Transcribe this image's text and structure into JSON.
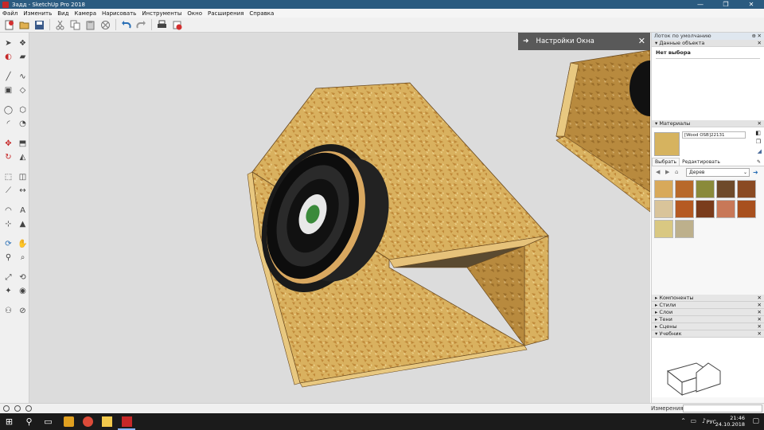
{
  "window": {
    "title": "Задд - SketchUp Pro 2018",
    "minimize": "—",
    "maximize": "❐",
    "close": "✕"
  },
  "menu": [
    "Файл",
    "Изменить",
    "Вид",
    "Камера",
    "Нарисовать",
    "Инструменты",
    "Окно",
    "Расширения",
    "Справка"
  ],
  "toolbar_icons": [
    "new-file-icon",
    "open-folder-icon",
    "save-icon",
    "cut-icon",
    "copy-icon",
    "paste-icon",
    "erase-icon",
    "undo-icon",
    "redo-icon",
    "print-icon",
    "model-info-icon"
  ],
  "left_tools": [
    "select-icon",
    "make-component-icon",
    "paint-bucket-icon",
    "eraser-icon",
    "line-icon",
    "freehand-icon",
    "rectangle-icon",
    "rotated-rectangle-icon",
    "circle-icon",
    "polygon-icon",
    "arc-icon",
    "pie-icon",
    "move-icon",
    "push-pull-icon",
    "rotate-icon",
    "follow-me-icon",
    "scale-icon",
    "offset-icon",
    "tape-measure-icon",
    "dimension-icon",
    "protractor-icon",
    "text-icon",
    "axes-icon",
    "3d-text-icon",
    "orbit-icon",
    "pan-icon",
    "zoom-icon",
    "zoom-window-icon",
    "zoom-extents-icon",
    "previous-view-icon",
    "position-camera-icon",
    "look-around-icon",
    "walk-icon",
    "section-plane-icon"
  ],
  "viewport": {
    "hint_panel": {
      "arrow": "➜",
      "title": "Настройки Окна",
      "close": "✕"
    }
  },
  "tray": {
    "title": "Лоток по умолчанию",
    "pin": "⊕",
    "close": "✕",
    "entity_info": {
      "header": "Данные объекта",
      "selection": "Нет выбора"
    },
    "materials": {
      "header": "Материалы",
      "material_name": "[Wood OSB]22131",
      "tab_select": "Выбрать",
      "tab_edit": "Редактировать",
      "library": "Дерев",
      "swatch_colors": [
        "#d8a95a",
        "#b8692a",
        "#8a8a3a",
        "#6e4a2a",
        "#8a4a22",
        "#d9c49a",
        "#b55a22",
        "#7a3c1c",
        "#c87858",
        "#a8501e",
        "#d9c882",
        "#bdb08c"
      ]
    },
    "collapsed_panels": [
      "Компоненты",
      "Стили",
      "Слои",
      "Тени",
      "Сцены"
    ],
    "instructor": {
      "header": "Учебник"
    }
  },
  "status": {
    "measurements_label": "Измерения",
    "measurements_value": ""
  },
  "taskbar": {
    "lang": "РУС",
    "time": "21:46",
    "date": "24.10.2018"
  }
}
